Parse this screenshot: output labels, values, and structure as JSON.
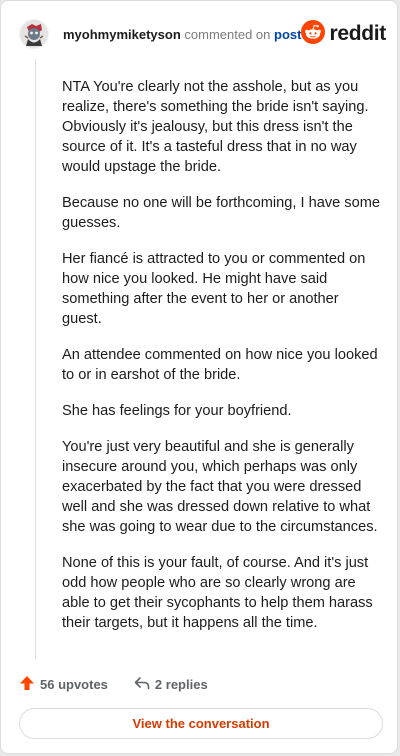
{
  "header": {
    "username": "myohmymiketyson",
    "action": "commented on",
    "target": "post",
    "brand_word": "reddit"
  },
  "comment": {
    "paragraphs": [
      "NTA You're clearly not the asshole, but as you realize, there's something the bride isn't saying. Obviously it's jealousy, but this dress isn't the source of it. It's a tasteful dress that in no way would upstage the bride.",
      "Because no one will be forthcoming, I have some guesses.",
      "Her fiancé is attracted to you or commented on how nice you looked. He might have said something after the event to her or another guest.",
      "An attendee commented on how nice you looked to or in earshot of the bride.",
      "She has feelings for your boyfriend.",
      "You're just very beautiful and she is generally insecure around you, which perhaps was only exacerbated by the fact that you were dressed well and she was dressed down relative to what she was going to wear due to the circumstances.",
      "None of this is your fault, of course. And it's just odd how people who are so clearly wrong are able to get their sycophants to help them harass their targets, but it happens all the time."
    ]
  },
  "footer": {
    "upvotes": "56 upvotes",
    "replies": "2 replies"
  },
  "view_button": "View the conversation",
  "colors": {
    "accent": "#ff4500",
    "link": "#0045ac",
    "view_text": "#d93a00"
  },
  "icons": {
    "avatar": "avatar",
    "logo": "reddit-alien-icon",
    "upvote": "upvote-arrow-icon",
    "reply": "reply-arrow-icon"
  }
}
